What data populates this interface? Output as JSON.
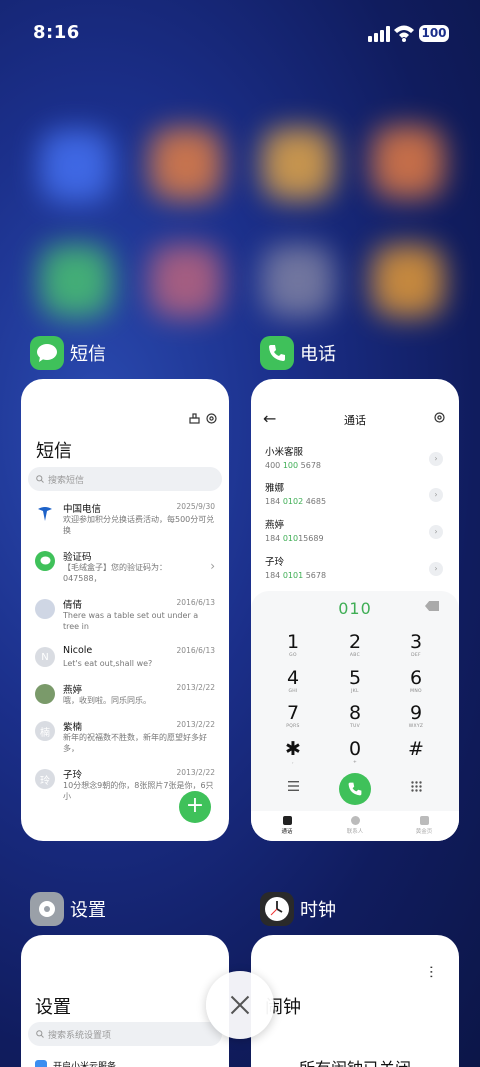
{
  "status": {
    "time": "8:16",
    "battery": "100"
  },
  "cards": {
    "sms": {
      "app_name": "短信",
      "title": "短信",
      "search_placeholder": "搜索短信",
      "messages": [
        {
          "name": "中国电信",
          "date": "2025/9/30",
          "preview": "欢迎参加积分兑换话费活动，每500分可兑换\n话费5元。兑换话费请回复106或jfdh#话费..."
        },
        {
          "name": "验证码",
          "date": "",
          "preview": "【毛绒盒子】您的验证码为：047588，\n请勿泄露于他人！"
        },
        {
          "name": "倩倩",
          "date": "2016/6/13",
          "preview": "There was a table set out under a tree in\nfront of the house,and the March Hare an..."
        },
        {
          "name": "Nicole",
          "date": "2016/6/13",
          "preview": "Let's eat out,shall we?"
        },
        {
          "name": "燕婷",
          "date": "2013/2/22",
          "preview": "哦，收到啦。同乐同乐。"
        },
        {
          "name": "紫楠",
          "date": "2013/2/22",
          "preview": "新年的祝福数不胜数，新年的愿望好多好多，\n新年的问候依旧美好，在这个温馨的时刻，..."
        },
        {
          "name": "子玲",
          "date": "2013/2/22",
          "preview": "10分想念9朝的你，8张照片7张是你，6只小\n狗5只像你，4根骨头3根归你，2爪着..."
        }
      ],
      "avatar_letters": {
        "nicole": "N",
        "zinan": "楠",
        "ziling": "玲"
      },
      "fab": "+"
    },
    "phone": {
      "app_name": "电话",
      "title": "通话",
      "contacts": [
        {
          "name": "小米客服",
          "num_a": "400 ",
          "num_b": "100",
          "num_c": " 5678"
        },
        {
          "name": "雅娜",
          "num_a": "184 ",
          "num_b": "0102",
          "num_c": " 4685"
        },
        {
          "name": "燕婷",
          "num_a": "184 ",
          "num_b": "010",
          "num_c": "15689"
        },
        {
          "name": "子玲",
          "num_a": "184 ",
          "num_b": "0101",
          "num_c": " 5678"
        }
      ],
      "dialed": "010",
      "keys": [
        {
          "d": "1",
          "l": "GO"
        },
        {
          "d": "2",
          "l": "ABC"
        },
        {
          "d": "3",
          "l": "DEF"
        },
        {
          "d": "4",
          "l": "GHI"
        },
        {
          "d": "5",
          "l": "JKL"
        },
        {
          "d": "6",
          "l": "MNO"
        },
        {
          "d": "7",
          "l": "PQRS"
        },
        {
          "d": "8",
          "l": "TUV"
        },
        {
          "d": "9",
          "l": "WXYZ"
        },
        {
          "d": "✱",
          "l": ","
        },
        {
          "d": "0",
          "l": "+"
        },
        {
          "d": "#",
          "l": ""
        }
      ],
      "nav": {
        "calls": "通话",
        "contacts": "联系人",
        "yellow": "黄金页"
      }
    },
    "settings": {
      "app_name": "设置",
      "title": "设置",
      "search_placeholder": "搜索系统设置项",
      "first_row": "开启小米云服务"
    },
    "clock": {
      "app_name": "时钟",
      "title": "闹钟",
      "empty_text": "所有闹钟已关闭"
    }
  },
  "colors": {
    "accent_green": "#3fc15a",
    "background": "#1b2f8a"
  }
}
